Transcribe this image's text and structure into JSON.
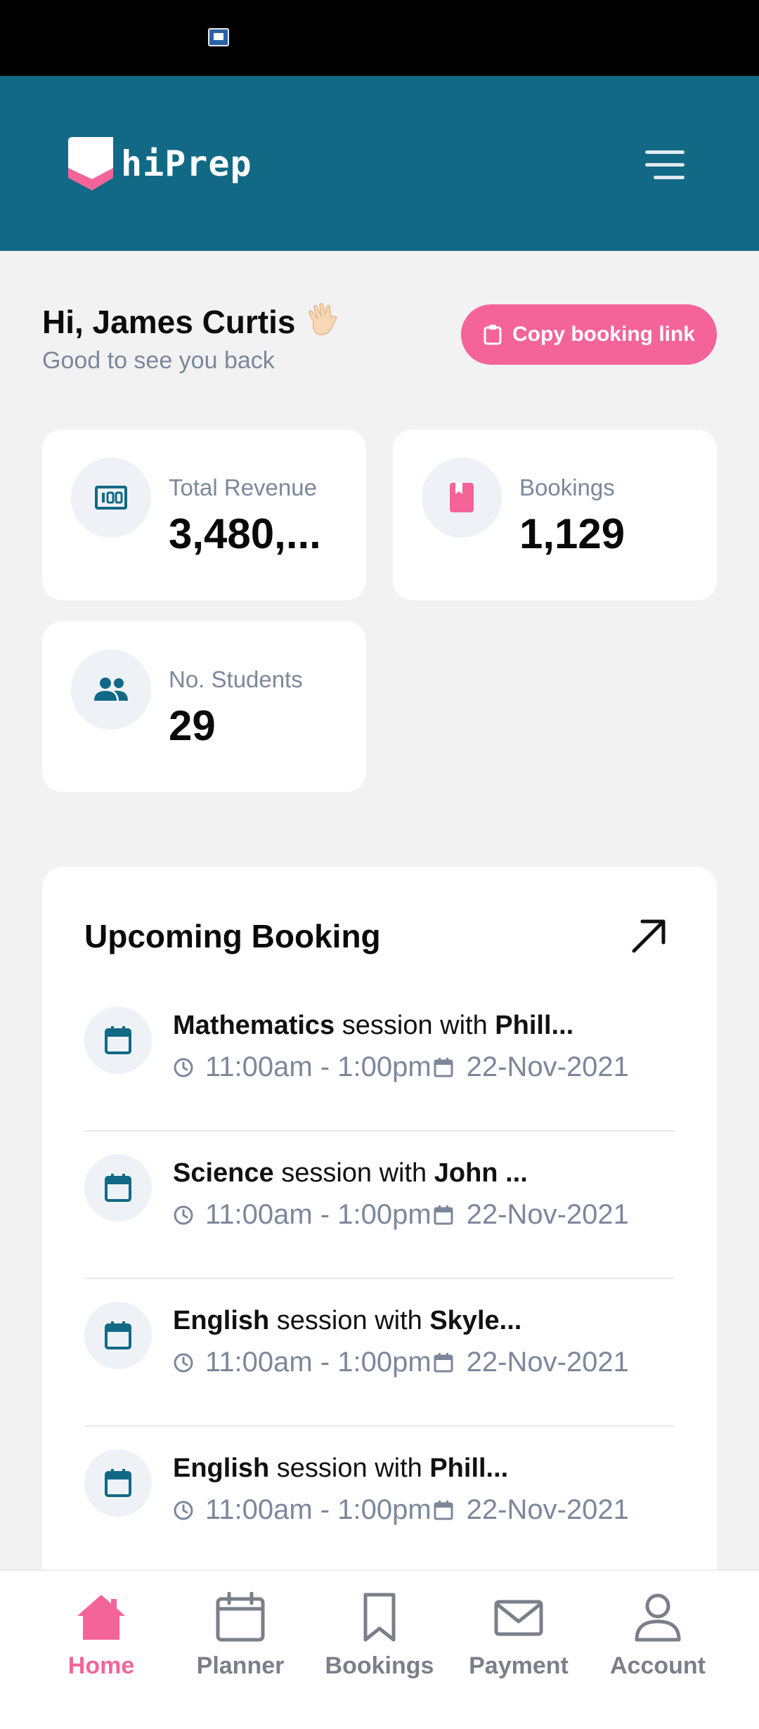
{
  "header": {
    "brand": "hiPrep",
    "logo_icon": "book-logo-icon",
    "menu_icon": "hamburger-menu-icon",
    "accent_color": "#126985"
  },
  "greeting": {
    "title": "Hi, James Curtis",
    "subtitle": "Good to see you back",
    "emoji_icon": "waving-hand-icon"
  },
  "copy_link_button": {
    "label": "Copy booking link",
    "icon": "clipboard-icon",
    "color": "#f46499"
  },
  "stats": [
    {
      "label": "Total Revenue",
      "value": "3,480,...",
      "icon": "money-icon"
    },
    {
      "label": "Bookings",
      "value": "1,129",
      "icon": "booking-book-icon"
    },
    {
      "label": "No. Students",
      "value": "29",
      "icon": "people-icon"
    }
  ],
  "upcoming": {
    "title": "Upcoming Booking",
    "expand_icon": "arrow-up-right-icon",
    "items": [
      {
        "subject": "Mathematics",
        "middle": " session with ",
        "person": "Phill...",
        "time": "11:00am - 1:00pm",
        "date": "22-Nov-2021"
      },
      {
        "subject": "Science",
        "middle": " session with ",
        "person": "John ...",
        "time": "11:00am - 1:00pm",
        "date": "22-Nov-2021"
      },
      {
        "subject": "English",
        "middle": " session with ",
        "person": "Skyle...",
        "time": "11:00am - 1:00pm",
        "date": "22-Nov-2021"
      },
      {
        "subject": "English",
        "middle": " session with ",
        "person": "Phill...",
        "time": "11:00am - 1:00pm",
        "date": "22-Nov-2021"
      }
    ]
  },
  "nav": {
    "items": [
      {
        "label": "Home",
        "icon": "home-icon",
        "active": true
      },
      {
        "label": "Planner",
        "icon": "calendar-icon",
        "active": false
      },
      {
        "label": "Bookings",
        "icon": "bookmark-icon",
        "active": false
      },
      {
        "label": "Payment",
        "icon": "envelope-icon",
        "active": false
      },
      {
        "label": "Account",
        "icon": "user-icon",
        "active": false
      }
    ],
    "active_color": "#f46499",
    "inactive_color": "#7a7f89"
  }
}
